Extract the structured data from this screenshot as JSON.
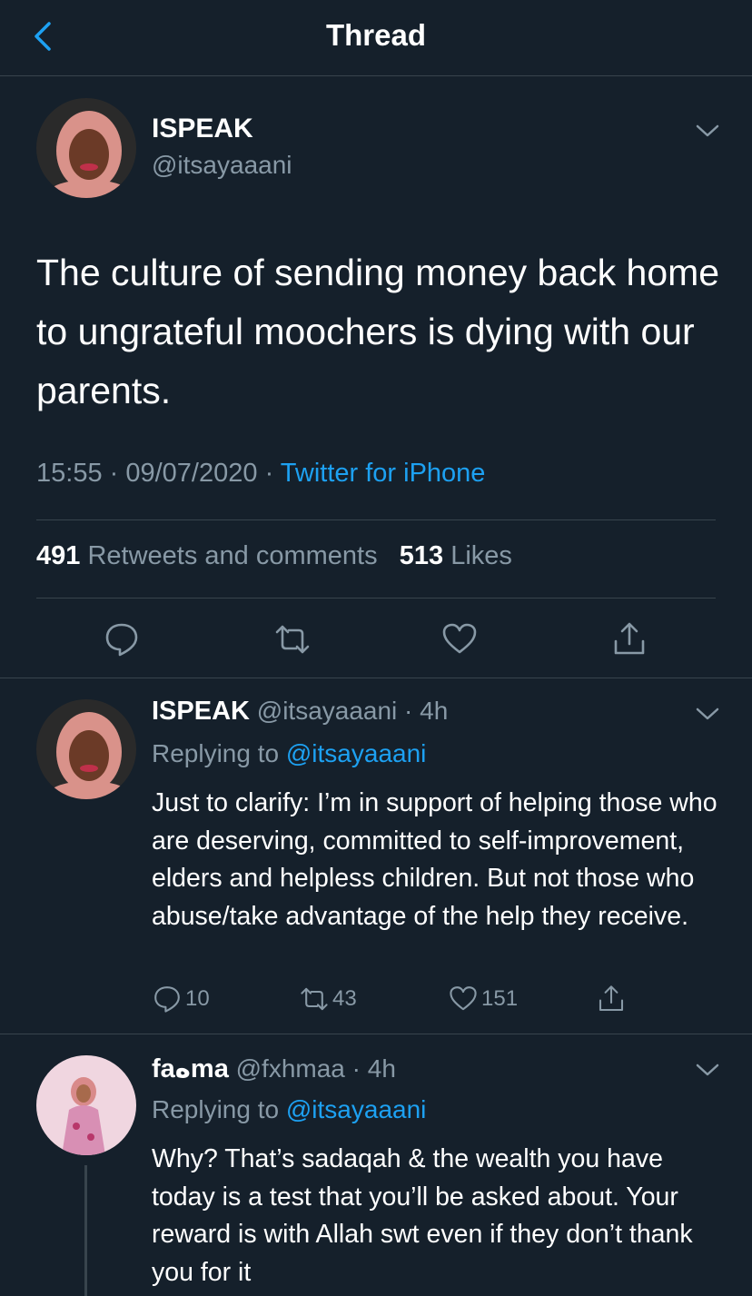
{
  "header": {
    "title": "Thread",
    "back_icon": "chevron-left-icon"
  },
  "main_tweet": {
    "name": "ISPEAK",
    "handle": "@itsayaaani",
    "text": "The culture of sending money back home to ungrateful moochers is dying with our parents.",
    "time": "15:55",
    "date": "09/07/2020",
    "source": "Twitter for iPhone",
    "retweets_count": "491",
    "retweets_label": "Retweets and comments",
    "likes_count": "513",
    "likes_label": "Likes"
  },
  "replies": [
    {
      "name": "ISPEAK",
      "handle": "@itsayaaani",
      "age": "4h",
      "replying_prefix": "Replying to",
      "replying_to": "@itsayaaani",
      "text": "Just to clarify: I’m in support of helping those who are deserving, committed to self-improvement, elders and helpless children. But not those who abuse/take advantage of the help they receive.",
      "comments": "10",
      "retweets": "43",
      "likes": "151"
    },
    {
      "name": "faهma",
      "handle": "@fxhmaa",
      "age": "4h",
      "replying_prefix": "Replying to",
      "replying_to": "@itsayaaani",
      "text": "Why? That’s sadaqah & the wealth you have today is a test that you’ll be asked about. Your reward is with Allah swt even if they don’t thank you for it"
    }
  ],
  "colors": {
    "background": "#15202b",
    "accent": "#1da1f2",
    "muted": "#8899a6",
    "divider": "#38444d"
  }
}
